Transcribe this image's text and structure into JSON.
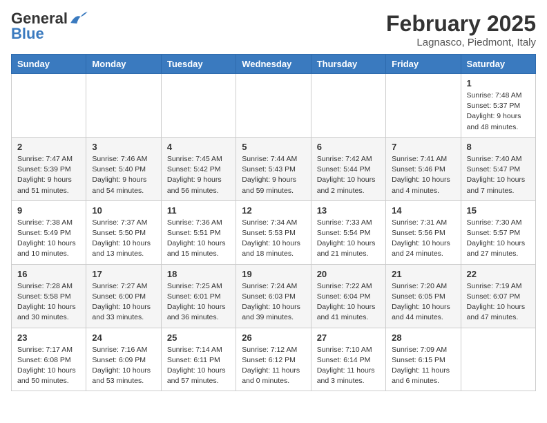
{
  "logo": {
    "line1": "General",
    "line2": "Blue"
  },
  "title": "February 2025",
  "location": "Lagnasco, Piedmont, Italy",
  "weekdays": [
    "Sunday",
    "Monday",
    "Tuesday",
    "Wednesday",
    "Thursday",
    "Friday",
    "Saturday"
  ],
  "weeks": [
    [
      {
        "day": "",
        "info": ""
      },
      {
        "day": "",
        "info": ""
      },
      {
        "day": "",
        "info": ""
      },
      {
        "day": "",
        "info": ""
      },
      {
        "day": "",
        "info": ""
      },
      {
        "day": "",
        "info": ""
      },
      {
        "day": "1",
        "info": "Sunrise: 7:48 AM\nSunset: 5:37 PM\nDaylight: 9 hours and 48 minutes."
      }
    ],
    [
      {
        "day": "2",
        "info": "Sunrise: 7:47 AM\nSunset: 5:39 PM\nDaylight: 9 hours and 51 minutes."
      },
      {
        "day": "3",
        "info": "Sunrise: 7:46 AM\nSunset: 5:40 PM\nDaylight: 9 hours and 54 minutes."
      },
      {
        "day": "4",
        "info": "Sunrise: 7:45 AM\nSunset: 5:42 PM\nDaylight: 9 hours and 56 minutes."
      },
      {
        "day": "5",
        "info": "Sunrise: 7:44 AM\nSunset: 5:43 PM\nDaylight: 9 hours and 59 minutes."
      },
      {
        "day": "6",
        "info": "Sunrise: 7:42 AM\nSunset: 5:44 PM\nDaylight: 10 hours and 2 minutes."
      },
      {
        "day": "7",
        "info": "Sunrise: 7:41 AM\nSunset: 5:46 PM\nDaylight: 10 hours and 4 minutes."
      },
      {
        "day": "8",
        "info": "Sunrise: 7:40 AM\nSunset: 5:47 PM\nDaylight: 10 hours and 7 minutes."
      }
    ],
    [
      {
        "day": "9",
        "info": "Sunrise: 7:38 AM\nSunset: 5:49 PM\nDaylight: 10 hours and 10 minutes."
      },
      {
        "day": "10",
        "info": "Sunrise: 7:37 AM\nSunset: 5:50 PM\nDaylight: 10 hours and 13 minutes."
      },
      {
        "day": "11",
        "info": "Sunrise: 7:36 AM\nSunset: 5:51 PM\nDaylight: 10 hours and 15 minutes."
      },
      {
        "day": "12",
        "info": "Sunrise: 7:34 AM\nSunset: 5:53 PM\nDaylight: 10 hours and 18 minutes."
      },
      {
        "day": "13",
        "info": "Sunrise: 7:33 AM\nSunset: 5:54 PM\nDaylight: 10 hours and 21 minutes."
      },
      {
        "day": "14",
        "info": "Sunrise: 7:31 AM\nSunset: 5:56 PM\nDaylight: 10 hours and 24 minutes."
      },
      {
        "day": "15",
        "info": "Sunrise: 7:30 AM\nSunset: 5:57 PM\nDaylight: 10 hours and 27 minutes."
      }
    ],
    [
      {
        "day": "16",
        "info": "Sunrise: 7:28 AM\nSunset: 5:58 PM\nDaylight: 10 hours and 30 minutes."
      },
      {
        "day": "17",
        "info": "Sunrise: 7:27 AM\nSunset: 6:00 PM\nDaylight: 10 hours and 33 minutes."
      },
      {
        "day": "18",
        "info": "Sunrise: 7:25 AM\nSunset: 6:01 PM\nDaylight: 10 hours and 36 minutes."
      },
      {
        "day": "19",
        "info": "Sunrise: 7:24 AM\nSunset: 6:03 PM\nDaylight: 10 hours and 39 minutes."
      },
      {
        "day": "20",
        "info": "Sunrise: 7:22 AM\nSunset: 6:04 PM\nDaylight: 10 hours and 41 minutes."
      },
      {
        "day": "21",
        "info": "Sunrise: 7:20 AM\nSunset: 6:05 PM\nDaylight: 10 hours and 44 minutes."
      },
      {
        "day": "22",
        "info": "Sunrise: 7:19 AM\nSunset: 6:07 PM\nDaylight: 10 hours and 47 minutes."
      }
    ],
    [
      {
        "day": "23",
        "info": "Sunrise: 7:17 AM\nSunset: 6:08 PM\nDaylight: 10 hours and 50 minutes."
      },
      {
        "day": "24",
        "info": "Sunrise: 7:16 AM\nSunset: 6:09 PM\nDaylight: 10 hours and 53 minutes."
      },
      {
        "day": "25",
        "info": "Sunrise: 7:14 AM\nSunset: 6:11 PM\nDaylight: 10 hours and 57 minutes."
      },
      {
        "day": "26",
        "info": "Sunrise: 7:12 AM\nSunset: 6:12 PM\nDaylight: 11 hours and 0 minutes."
      },
      {
        "day": "27",
        "info": "Sunrise: 7:10 AM\nSunset: 6:14 PM\nDaylight: 11 hours and 3 minutes."
      },
      {
        "day": "28",
        "info": "Sunrise: 7:09 AM\nSunset: 6:15 PM\nDaylight: 11 hours and 6 minutes."
      },
      {
        "day": "",
        "info": ""
      }
    ]
  ]
}
